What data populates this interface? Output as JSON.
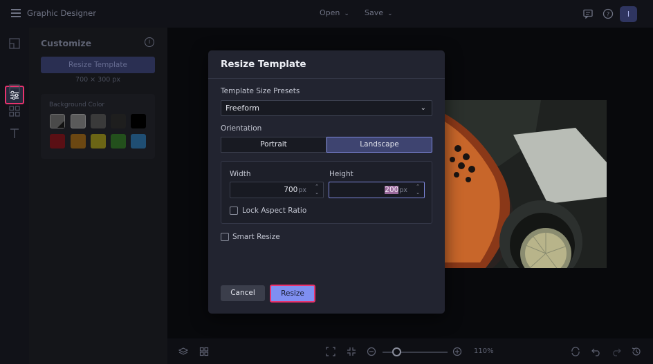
{
  "app": {
    "title": "Graphic Designer",
    "avatar_initial": "I"
  },
  "topbar": {
    "open_label": "Open",
    "save_label": "Save"
  },
  "panel": {
    "title": "Customize",
    "resize_button": "Resize Template",
    "size_caption": "700 × 300 px",
    "background_label": "Background Color",
    "swatches": [
      "#4a4a4a",
      "#5a5a5a",
      "#3a3a3a",
      "#1e1e1e",
      "#000000",
      "#5a0f14",
      "#6b4712",
      "#6b6515",
      "#23501c",
      "#1f4e73"
    ]
  },
  "zoom": {
    "level": "110%",
    "fraction": 0.15
  },
  "modal": {
    "title": "Resize Template",
    "presets_label": "Template Size Presets",
    "preset_value": "Freeform",
    "orientation_label": "Orientation",
    "portrait_label": "Portrait",
    "landscape_label": "Landscape",
    "width_label": "Width",
    "width_value": "700",
    "height_label": "Height",
    "height_value": "200",
    "unit": "px",
    "lock_aspect_label": "Lock Aspect Ratio",
    "smart_resize_label": "Smart Resize",
    "cancel_label": "Cancel",
    "resize_label": "Resize"
  }
}
